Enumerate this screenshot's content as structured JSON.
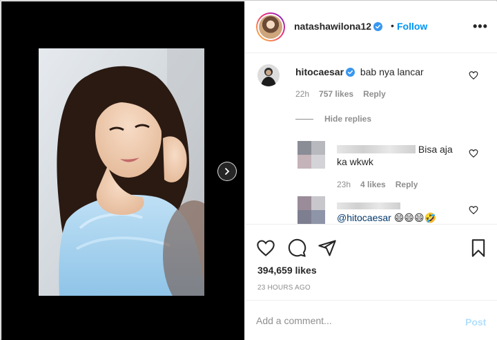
{
  "post": {
    "author": "natashawilona12",
    "separator": "•",
    "follow_label": "Follow",
    "more_label": "•••",
    "carousel": {
      "slide_count": 2,
      "active_index": 0
    }
  },
  "comments": [
    {
      "username": "hitocaesar",
      "text": "bab nya lancar",
      "time": "22h",
      "likes": "757 likes",
      "reply_label": "Reply"
    }
  ],
  "hide_replies_label": "Hide replies",
  "replies": [
    {
      "text_line1": "Bisa aja",
      "text_line2": "ka wkwk",
      "time": "23h",
      "likes": "4 likes",
      "reply_label": "Reply"
    },
    {
      "mention": "@hitocaesar",
      "emoji": "😄😄😄🤣"
    }
  ],
  "actions": {
    "likes": "394,659 likes",
    "posted": "23 HOURS AGO"
  },
  "add_comment": {
    "placeholder": "Add a comment...",
    "post_label": "Post"
  },
  "colors": {
    "link_blue": "#0095f6",
    "post_disabled": "#b2dffc",
    "muted": "#8e8e8e",
    "text": "#262626"
  }
}
